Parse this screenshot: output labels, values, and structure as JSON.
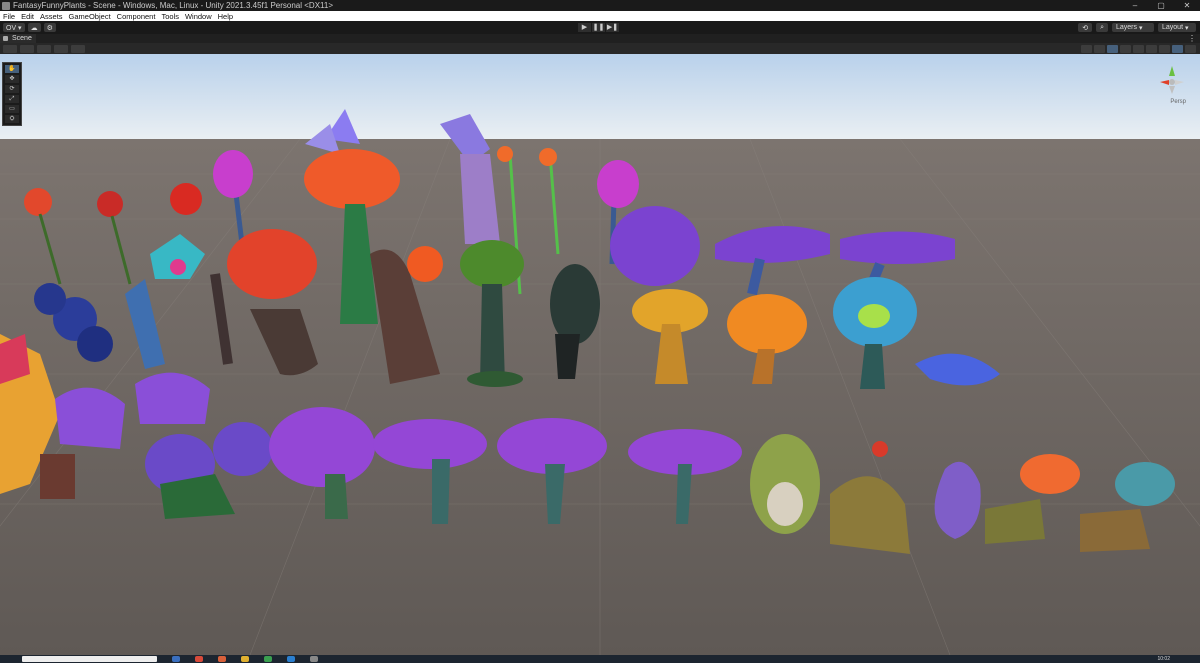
{
  "window": {
    "title": "FantasyFunnyPlants - Scene - Windows, Mac, Linux - Unity 2021.3.45f1 Personal <DX11>",
    "minimize": "–",
    "maximize": "▢",
    "close": "✕"
  },
  "menu": [
    "File",
    "Edit",
    "Assets",
    "GameObject",
    "Component",
    "Tools",
    "Window",
    "Help"
  ],
  "toolbar": {
    "account_label": "OV ▾",
    "cloud": "☁",
    "services": "⚙",
    "play": "▶",
    "pause": "❚❚",
    "step": "▶❚",
    "history": "⟲",
    "search": "⌕",
    "layers_label": "Layers",
    "layout_label": "Layout"
  },
  "tabs": [
    {
      "label": "Scene"
    }
  ],
  "tab_more": "⋮",
  "scene_tools": [
    "✋",
    "✥",
    "⟳",
    "⤢",
    "▭",
    "⛭"
  ],
  "gizmo": {
    "label": "Persp"
  },
  "taskbar": {
    "clock": "10:02"
  },
  "colors": {
    "sky_top": "#c9dcef",
    "ground": "#6b6561",
    "accent": "#46607c"
  }
}
